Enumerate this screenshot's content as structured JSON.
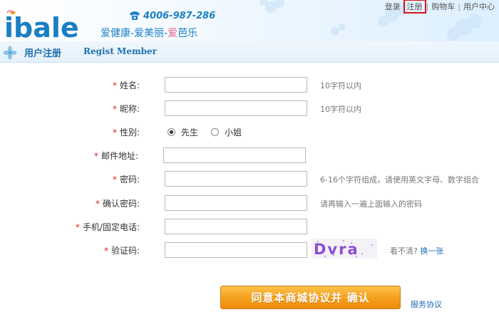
{
  "header": {
    "logo_text": "ibale",
    "hotline": "4006-987-286",
    "tagline_part1": "爱健康-爱美丽-",
    "tagline_part2": "爱",
    "tagline_part3": "芭乐"
  },
  "topnav": {
    "login": "登录",
    "register": "注册",
    "cart": "购物车",
    "user_center": "用户中心",
    "sep": "|"
  },
  "title": {
    "cn": "用户注册",
    "en": "Regist Member"
  },
  "form": {
    "required_mark": "*",
    "name": {
      "label": "姓名:",
      "value": "",
      "hint": "10字符以内"
    },
    "nickname": {
      "label": "昵称:",
      "value": "",
      "hint": "10字符以内"
    },
    "gender": {
      "label": "性别:",
      "options": [
        "先生",
        "小姐"
      ],
      "selected": "先生"
    },
    "email": {
      "label": "邮件地址:",
      "value": ""
    },
    "password": {
      "label": "密码:",
      "value": "",
      "hint": "6-16个字符组成，请使用英文字母、数字组合"
    },
    "confirm_password": {
      "label": "确认密码:",
      "value": "",
      "hint": "请再输入一遍上面输入的密码"
    },
    "phone": {
      "label": "手机/固定电话:",
      "value": ""
    },
    "captcha": {
      "label": "验证码:",
      "value": "",
      "image_text": "Dvra",
      "hint": "看不清?",
      "refresh": "换一张"
    },
    "submit_label": "同意本商城协议并 确认",
    "terms_link": "服务协议"
  },
  "colors": {
    "brand_blue": "#1a7fc4",
    "accent_pink": "#e8608a",
    "required_red": "#e02020",
    "button_orange": "#f5a11f",
    "link_blue": "#1a6fb8"
  }
}
